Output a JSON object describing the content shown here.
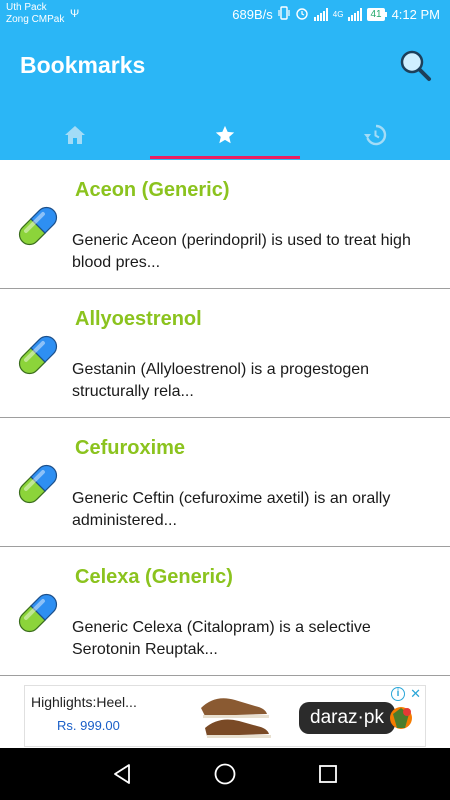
{
  "status_bar": {
    "carrier_line1": "Uth Pack",
    "carrier_line2": "Zong CMPak",
    "speed": "689B/s",
    "net_label": "4G",
    "battery": "41",
    "time": "4:12 PM"
  },
  "app_bar": {
    "title": "Bookmarks",
    "icons": {
      "search": "search-icon"
    },
    "tabs": [
      {
        "icon": "home-icon"
      },
      {
        "icon": "star-icon",
        "selected": true
      },
      {
        "icon": "history-icon"
      }
    ]
  },
  "colors": {
    "primary": "#2bb6f6",
    "tab_indicator": "#e91e63",
    "item_title": "#8bc31e"
  },
  "items": [
    {
      "title": "Aceon (Generic)",
      "desc": "Generic Aceon (perindopril) is used to treat high blood pres..."
    },
    {
      "title": "Allyoestrenol",
      "desc": "Gestanin (Allyloestrenol) is a progestogen structurally rela..."
    },
    {
      "title": "Cefuroxime",
      "desc": "Generic Ceftin (cefuroxime axetil) is an orally administered..."
    },
    {
      "title": "Celexa (Generic)",
      "desc": "Generic Celexa (Citalopram) is a selective Serotonin Reuptak..."
    }
  ],
  "ad": {
    "headline": "Highlights:Heel...",
    "price": "Rs. 999.00",
    "brand": "daraz·pk"
  },
  "nav": {
    "back": "back-icon",
    "home": "home-circle-icon",
    "recents": "recents-icon"
  }
}
